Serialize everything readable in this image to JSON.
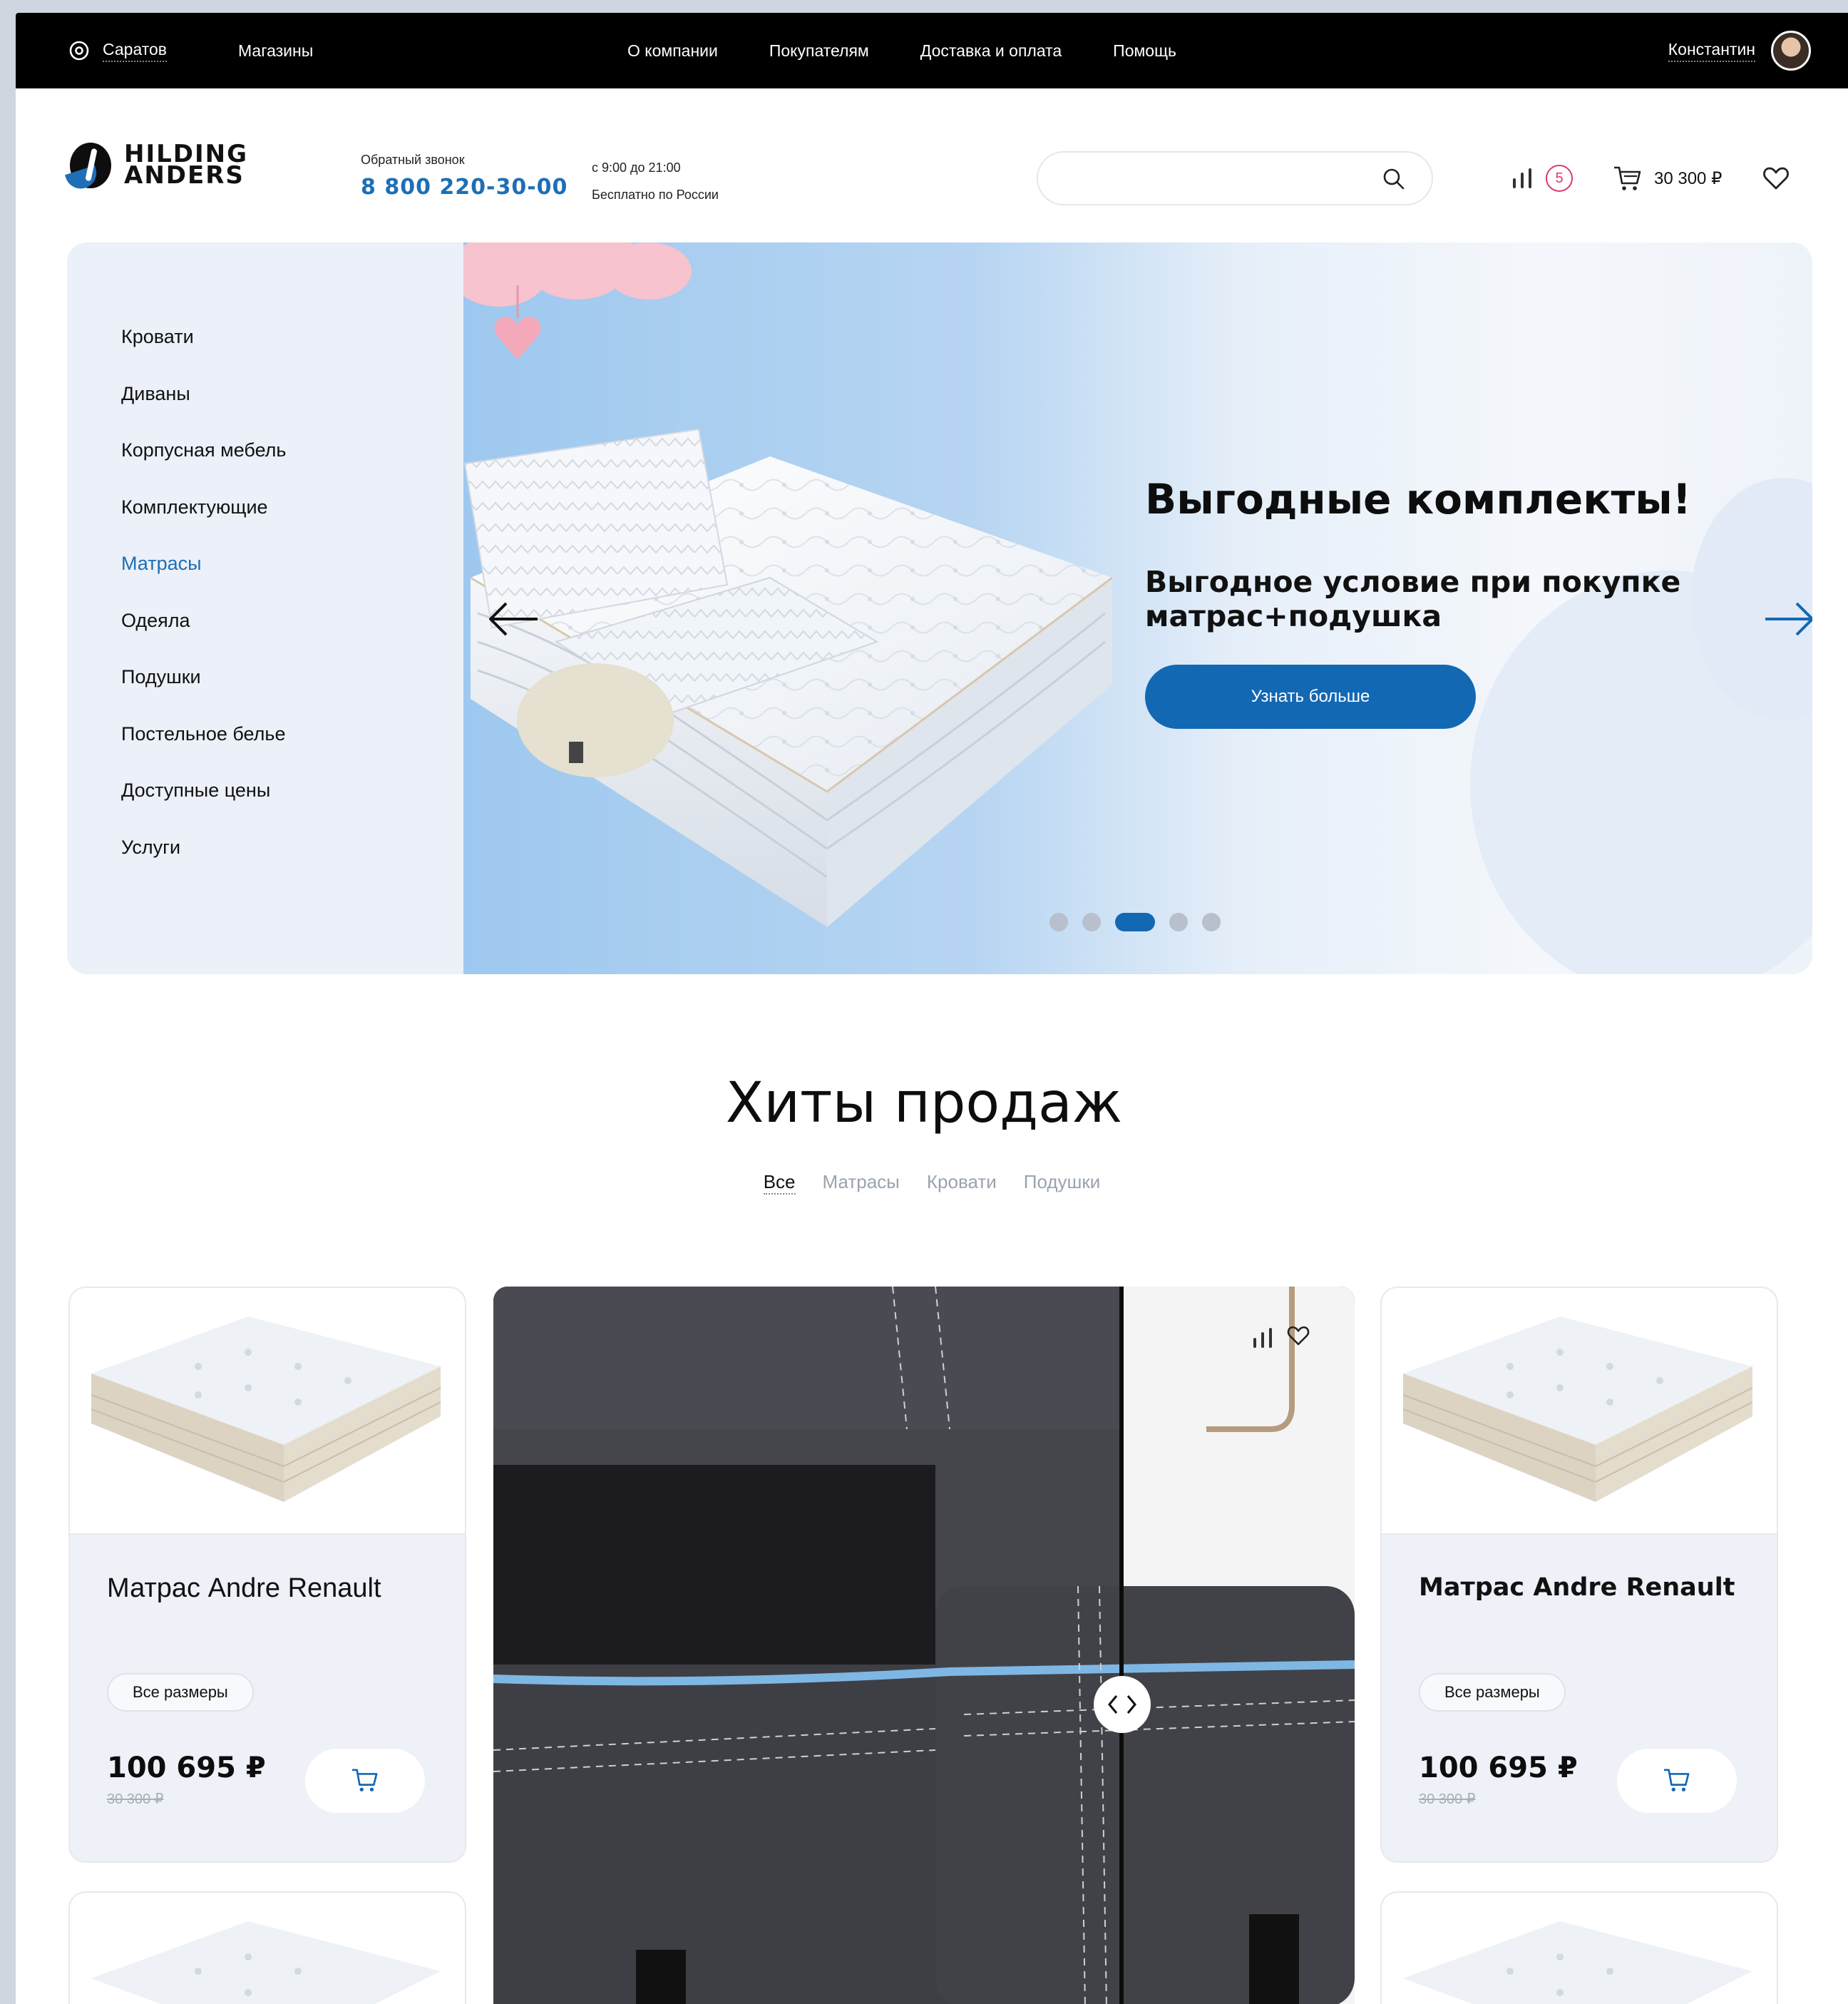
{
  "topbar": {
    "city": "Саратов",
    "stores": "Магазины",
    "nav": [
      "О компании",
      "Покупателям",
      "Доставка и оплата",
      "Помощь"
    ],
    "user_name": "Константин"
  },
  "header": {
    "logo_line1": "HILDING",
    "logo_line2": "ANDERS",
    "callback_label": "Обратный звонок",
    "phone": "8 800 220-30-00",
    "hours_line1": "с 9:00 до 21:00",
    "hours_line2": "Бесплатно по России",
    "search_value": "",
    "compare_count": "5",
    "cart_total": "30 300 ₽"
  },
  "categories": [
    {
      "label": "Кровати",
      "active": false
    },
    {
      "label": "Диваны",
      "active": false
    },
    {
      "label": "Корпусная мебель",
      "active": false
    },
    {
      "label": "Комплектующие",
      "active": false
    },
    {
      "label": "Матрасы",
      "active": true
    },
    {
      "label": "Одеяла",
      "active": false
    },
    {
      "label": "Подушки",
      "active": false
    },
    {
      "label": "Постельное белье",
      "active": false
    },
    {
      "label": "Доступные цены",
      "active": false
    },
    {
      "label": "Услуги",
      "active": false
    }
  ],
  "hero": {
    "title": "Выгодные комплекты!",
    "subtitle_line1": "Выгодное условие при покупке",
    "subtitle_line2": "матрас+подушка",
    "button": "Узнать больше",
    "slides_total": 5,
    "active_slide": 3
  },
  "hits": {
    "title": "Хиты продаж",
    "filters": [
      {
        "label": "Все",
        "active": true
      },
      {
        "label": "Матрасы",
        "active": false
      },
      {
        "label": "Кровати",
        "active": false
      },
      {
        "label": "Подушки",
        "active": false
      }
    ],
    "products": [
      {
        "name": "Матрас Andre Renault",
        "sizes": "Все размеры",
        "price": "100 695 ₽",
        "old_price": "30 300 ₽"
      },
      {
        "name": "Матрас Andre Renault",
        "sizes": "Все размеры",
        "price": "100 695 ₽",
        "old_price": "30 300 ₽"
      }
    ]
  },
  "icons": {
    "location": "location-pin-icon",
    "search": "search-icon",
    "compare": "compare-bars-icon",
    "cart": "cart-icon",
    "favorite": "heart-icon",
    "prev": "arrow-left-icon",
    "next": "arrow-right-icon",
    "slider_handle": "chevrons-left-right-icon"
  },
  "colors": {
    "accent": "#1368b4",
    "badge": "#e0376e",
    "topbar": "#000000"
  }
}
